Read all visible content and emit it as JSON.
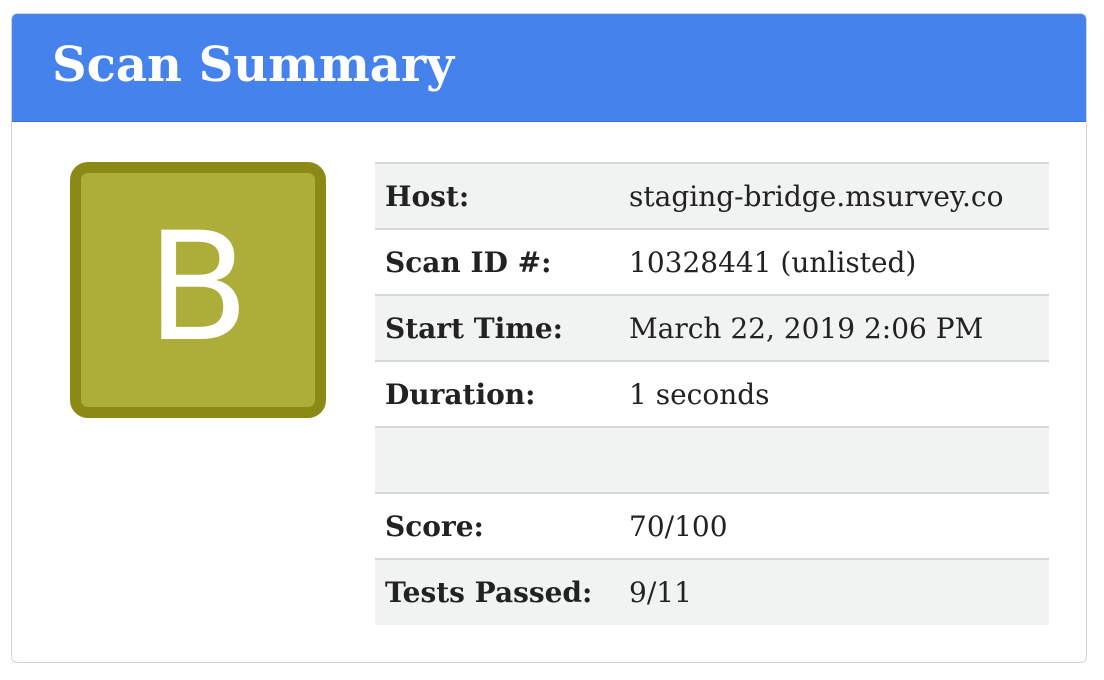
{
  "header": {
    "title": "Scan Summary",
    "background_color": "#4582ec"
  },
  "grade": {
    "letter": "B",
    "fill_color": "#adad3a",
    "border_color": "#8a8a14"
  },
  "summary": {
    "rows": [
      {
        "label": "Host:",
        "value": "staging-bridge.msurvey.co"
      },
      {
        "label": "Scan ID #:",
        "value": "10328441 (unlisted)"
      },
      {
        "label": "Start Time:",
        "value": "March 22, 2019 2:06 PM"
      },
      {
        "label": "Duration:",
        "value": "1 seconds"
      },
      {
        "label": "",
        "value": ""
      },
      {
        "label": "Score:",
        "value": "70/100"
      },
      {
        "label": "Tests Passed:",
        "value": "9/11"
      }
    ]
  }
}
